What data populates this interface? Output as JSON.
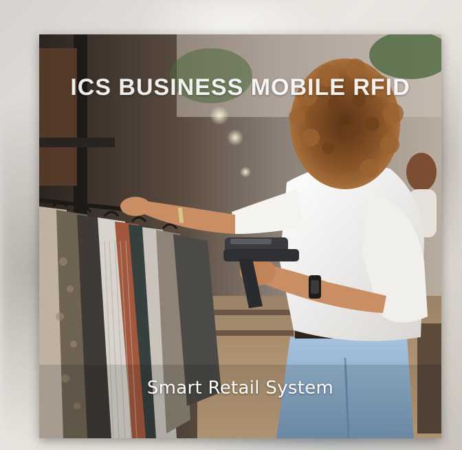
{
  "image": {
    "title": "ICS BUSINESS MOBILE RFID",
    "subtitle": "Smart Retail System"
  },
  "colors": {
    "title_text": "#ffffff",
    "subtitle_text": "#ffffff",
    "shirt": "#f4f3f1",
    "jeans": "#8fb1cf",
    "hair": "#7a4a24",
    "scanner": "#3a3b3e"
  },
  "icons": [
    "rfid-scanner",
    "wrist-watch",
    "clothing-rack"
  ]
}
